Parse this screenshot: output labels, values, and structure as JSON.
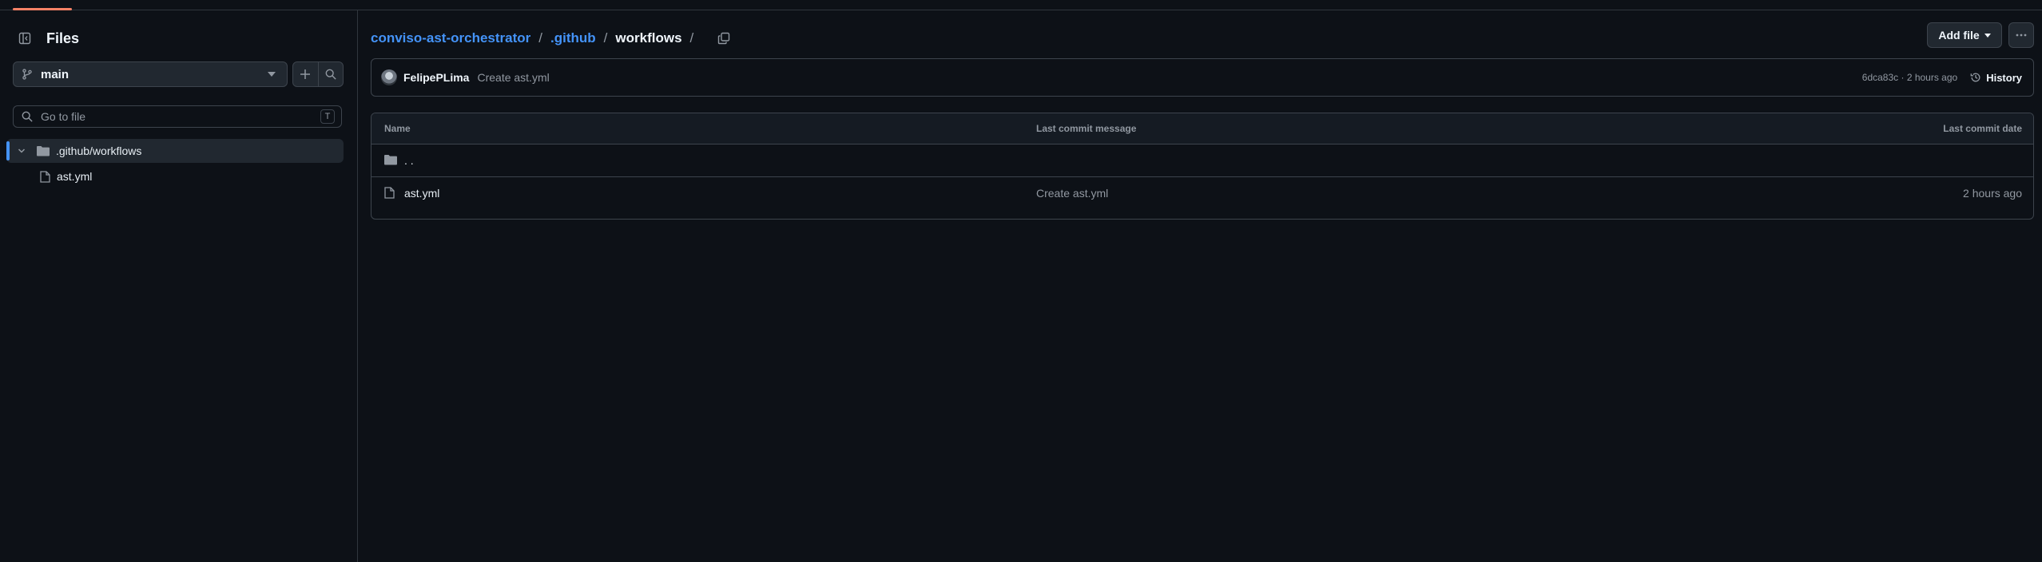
{
  "sidebar": {
    "title": "Files",
    "branch": "main",
    "search_placeholder": "Go to file",
    "search_shortcut": "T",
    "tree": [
      {
        "label": ".github/workflows",
        "type": "folder"
      },
      {
        "label": "ast.yml",
        "type": "file"
      }
    ]
  },
  "breadcrumb": {
    "repo": "conviso-ast-orchestrator",
    "sep": "/",
    "folder": ".github",
    "current": "workflows"
  },
  "toolbar": {
    "add_file_label": "Add file"
  },
  "commit": {
    "author": "FelipePLima",
    "message": "Create ast.yml",
    "hash_time": "6dca83c · 2 hours ago",
    "history_label": "History"
  },
  "table": {
    "headers": {
      "name": "Name",
      "message": "Last commit message",
      "date": "Last commit date"
    },
    "parent_label": ". .",
    "rows": [
      {
        "name": "ast.yml",
        "message": "Create ast.yml",
        "date": "2 hours ago"
      }
    ]
  }
}
